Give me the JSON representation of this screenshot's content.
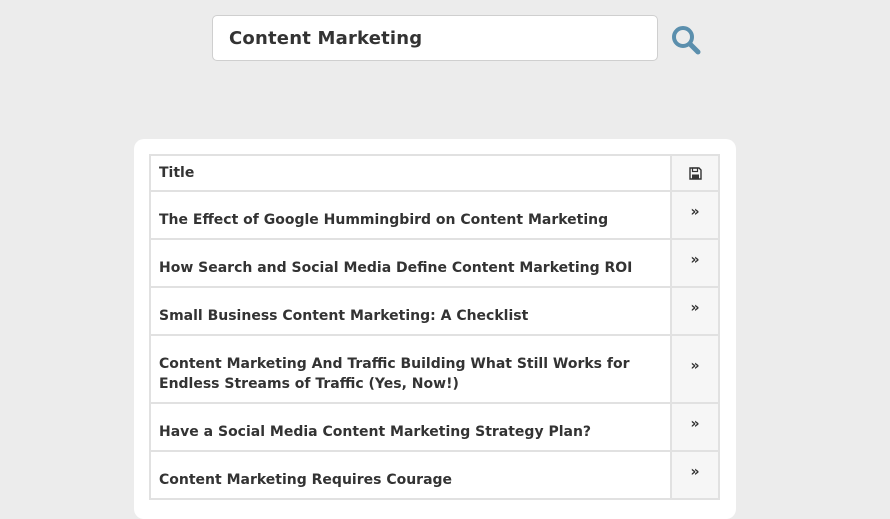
{
  "search": {
    "value": "Content Marketing",
    "icon": "search-icon",
    "icon_color": "#5b8fad"
  },
  "table": {
    "header_title": "Title",
    "header_action_icon": "save-icon",
    "row_action_icon": "double-chevron-right-icon",
    "row_action_glyph": "»",
    "rows": [
      {
        "title": "The Effect of Google Hummingbird on Content Marketing"
      },
      {
        "title": "How Search and Social Media Define Content Marketing ROI"
      },
      {
        "title": "Small Business Content Marketing: A Checklist"
      },
      {
        "title": "Content Marketing And Traffic Building What Still Works for Endless Streams of Traffic (Yes, Now!)"
      },
      {
        "title": "Have a Social Media Content Marketing Strategy Plan?"
      },
      {
        "title": "Content Marketing Requires Courage"
      }
    ]
  }
}
